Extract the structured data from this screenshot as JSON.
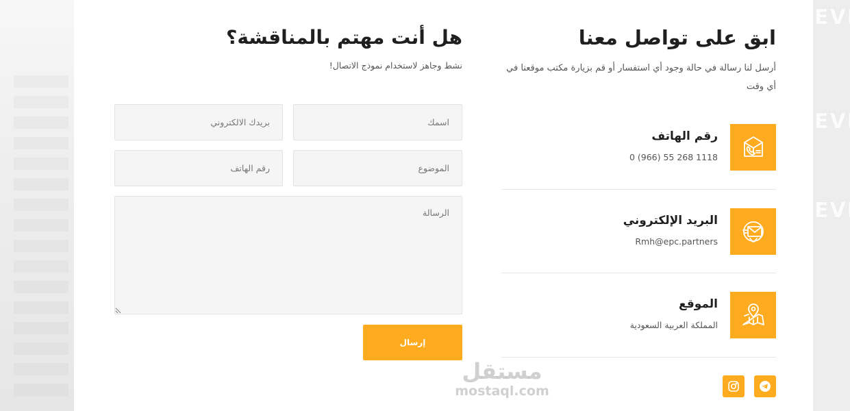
{
  "contact": {
    "title": "ابق على تواصل معنا",
    "description": "أرسل لنا رسالة في حالة وجود أي استفسار أو قم بزيارة مكتب موقعنا في أي وقت",
    "items": [
      {
        "label": "رقم الهاتف",
        "value": "0 (966) 55 268 1118",
        "icon": "phone-box-icon"
      },
      {
        "label": "البريد الإلكتروني",
        "value": "Rmh@epc.partners",
        "icon": "email-icon"
      },
      {
        "label": "الموقع",
        "value": "المملكة العربية السعودية",
        "icon": "map-location-icon"
      }
    ],
    "social": [
      "telegram-icon",
      "instagram-icon"
    ]
  },
  "form": {
    "title": "هل أنت مهتم بالمناقشة؟",
    "subtitle": "نشط وجاهز لاستخدام نموذج الاتصال!",
    "name_placeholder": "اسمك",
    "email_placeholder": "بريدك الالكتروني",
    "subject_placeholder": "الموضوع",
    "phone_placeholder": "رقم الهاتف",
    "message_placeholder": "الرسالة",
    "send_label": "إرسال"
  },
  "watermark": {
    "arabic": "مستقل",
    "latin": "mostaql.com"
  },
  "background_text": [
    "EVER",
    "EVER",
    "EVER"
  ],
  "colors": {
    "accent": "#ffab1f",
    "title": "#1f1f1f",
    "field_bg": "#f5f5f5"
  }
}
